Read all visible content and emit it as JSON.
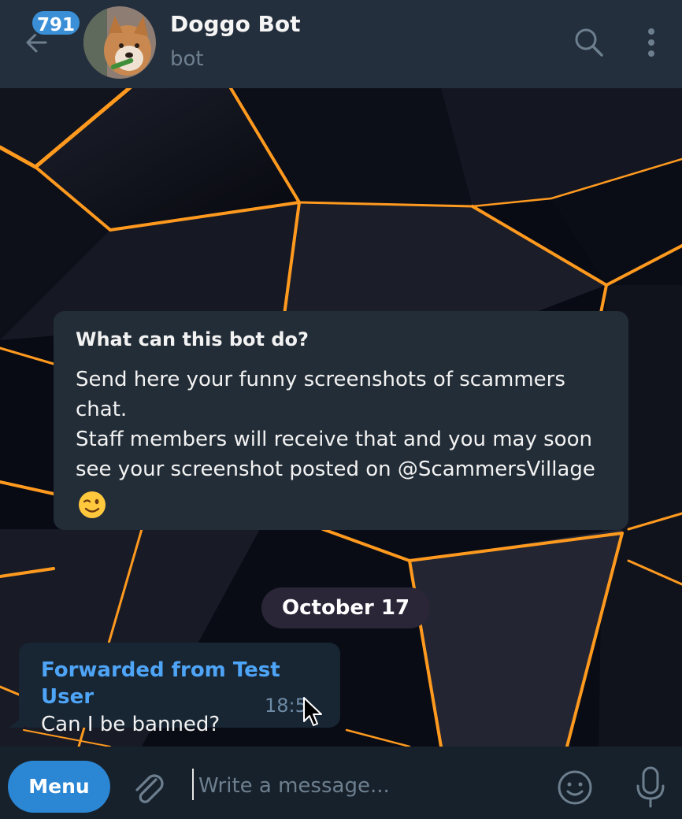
{
  "header": {
    "unread_count": "791",
    "title": "Doggo Bot",
    "subtitle": "bot"
  },
  "info_card": {
    "title": "What can this bot do?",
    "lines": [
      "Send here your funny screenshots of scammers",
      "chat.",
      "Staff members will receive that and you may soon",
      "see your screenshot posted on @ScammersVillage"
    ]
  },
  "date_separator": "October 17",
  "message": {
    "forwarded_from": "Forwarded from Test User",
    "text": "Can I be banned?",
    "time": "18:5"
  },
  "composer": {
    "menu_label": "Menu",
    "placeholder": "Write a message..."
  },
  "colors": {
    "accent": "#2b86d4",
    "link": "#4ea4f6",
    "header_bg": "#242f3d",
    "bubble_bg": "#182533",
    "background_glow": "#ff9a1f"
  }
}
